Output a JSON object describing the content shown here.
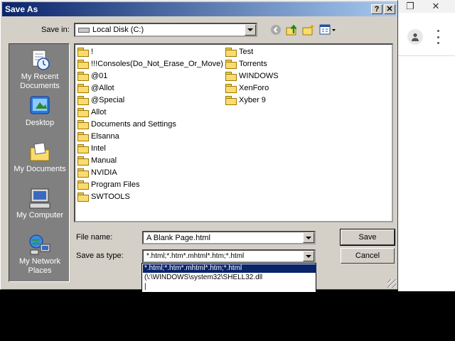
{
  "window": {
    "title": "Save As"
  },
  "save_in": {
    "label": "Save in:",
    "value": "Local Disk (C:)"
  },
  "places": [
    {
      "label_lines": [
        "My Recent",
        "Documents"
      ],
      "icon": "recent-documents-icon"
    },
    {
      "label_lines": [
        "Desktop"
      ],
      "icon": "desktop-icon"
    },
    {
      "label_lines": [
        "My Documents"
      ],
      "icon": "my-documents-icon"
    },
    {
      "label_lines": [
        "My Computer"
      ],
      "icon": "my-computer-icon"
    },
    {
      "label_lines": [
        "My Network",
        "Places"
      ],
      "icon": "network-places-icon"
    }
  ],
  "folders_col1": [
    "!",
    "!!!Consoles(Do_Not_Erase_Or_Move)",
    "@01",
    "@Allot",
    "@Special",
    "Allot",
    "Documents and Settings",
    "Elsanna",
    "Intel",
    "Manual",
    "NVIDIA",
    "Program Files",
    "SWTOOLS"
  ],
  "folders_col2": [
    "Test",
    "Torrents",
    "WINDOWS",
    "XenForo",
    "Xyber 9"
  ],
  "file_name": {
    "label": "File name:",
    "value": "A Blank Page.html"
  },
  "save_as_type": {
    "label": "Save as type:",
    "value": "*.html;*.htm*.mhtml*.htm;*.html",
    "options": [
      "*.html;*.htm*.mhtml*.htm;*.html",
      "(\\:\\WINDOWS\\system32\\SHELL32.dll",
      "|"
    ]
  },
  "buttons": {
    "save": "Save",
    "cancel": "Cancel",
    "help": "?",
    "close": "✕"
  }
}
